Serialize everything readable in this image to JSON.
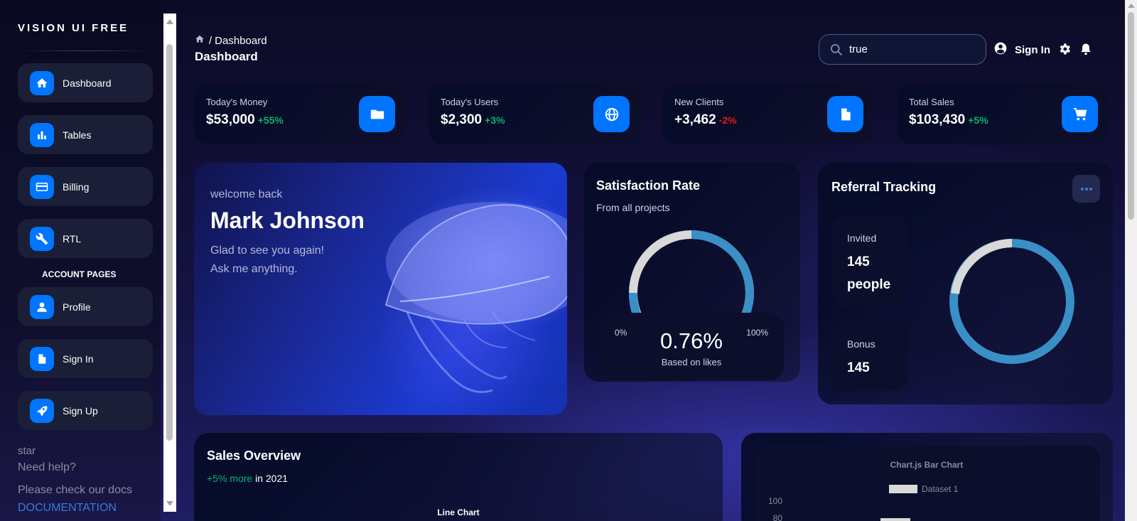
{
  "sidebar": {
    "brand": "VISION UI FREE",
    "items": [
      {
        "label": "Dashboard",
        "icon": "home-icon"
      },
      {
        "label": "Tables",
        "icon": "bar-chart-icon"
      },
      {
        "label": "Billing",
        "icon": "credit-card-icon"
      },
      {
        "label": "RTL",
        "icon": "wrench-icon"
      }
    ],
    "account_title": "ACCOUNT PAGES",
    "account_items": [
      {
        "label": "Profile",
        "icon": "person-icon"
      },
      {
        "label": "Sign In",
        "icon": "document-icon"
      },
      {
        "label": "Sign Up",
        "icon": "rocket-icon"
      }
    ],
    "help_star": "star",
    "help_title": "Need help?",
    "help_text": "Please check our docs",
    "docs_link": "DOCUMENTATION"
  },
  "header": {
    "breadcrumb_sep": "/",
    "breadcrumb_current": "Dashboard",
    "title": "Dashboard",
    "search_value": "true",
    "signin_label": "Sign In"
  },
  "stats": [
    {
      "title": "Today's Money",
      "value": "$53,000",
      "change": "+55%",
      "change_color": "#01b574",
      "icon": "folder-icon"
    },
    {
      "title": "Today's Users",
      "value": "$2,300",
      "change": "+3%",
      "change_color": "#01b574",
      "icon": "globe-icon"
    },
    {
      "title": "New Clients",
      "value": "+3,462",
      "change": "-2%",
      "change_color": "#e31a1a",
      "icon": "document-icon"
    },
    {
      "title": "Total Sales",
      "value": "$103,430",
      "change": "+5%",
      "change_color": "#01b574",
      "icon": "cart-icon"
    }
  ],
  "welcome": {
    "greeting": "welcome back",
    "name": "Mark Johnson",
    "line1": "Glad to see you again!",
    "line2": "Ask me anything."
  },
  "satisfaction": {
    "title": "Satisfaction Rate",
    "subtitle": "From all projects",
    "min_label": "0%",
    "max_label": "100%",
    "value": "0.76%",
    "note": "Based on likes",
    "accent": "#3a8fc7"
  },
  "referral": {
    "title": "Referral Tracking",
    "invited_label": "Invited",
    "invited_value": "145 people",
    "bonus_label": "Bonus",
    "bonus_value": "145",
    "accent": "#3a8fc7"
  },
  "sales": {
    "title": "Sales Overview",
    "change": "+5% more",
    "period": " in 2021",
    "chart_title": "Line Chart"
  },
  "bar_chart": {
    "chart_data": {
      "type": "bar",
      "title": "Chart.js Bar Chart",
      "series": [
        {
          "name": "Dataset 1",
          "values": [
            80
          ]
        }
      ],
      "y_ticks": [
        "100",
        "80"
      ]
    }
  },
  "colors": {
    "accent_blue": "#0075ff",
    "positive": "#01b574",
    "negative": "#e31a1a"
  }
}
